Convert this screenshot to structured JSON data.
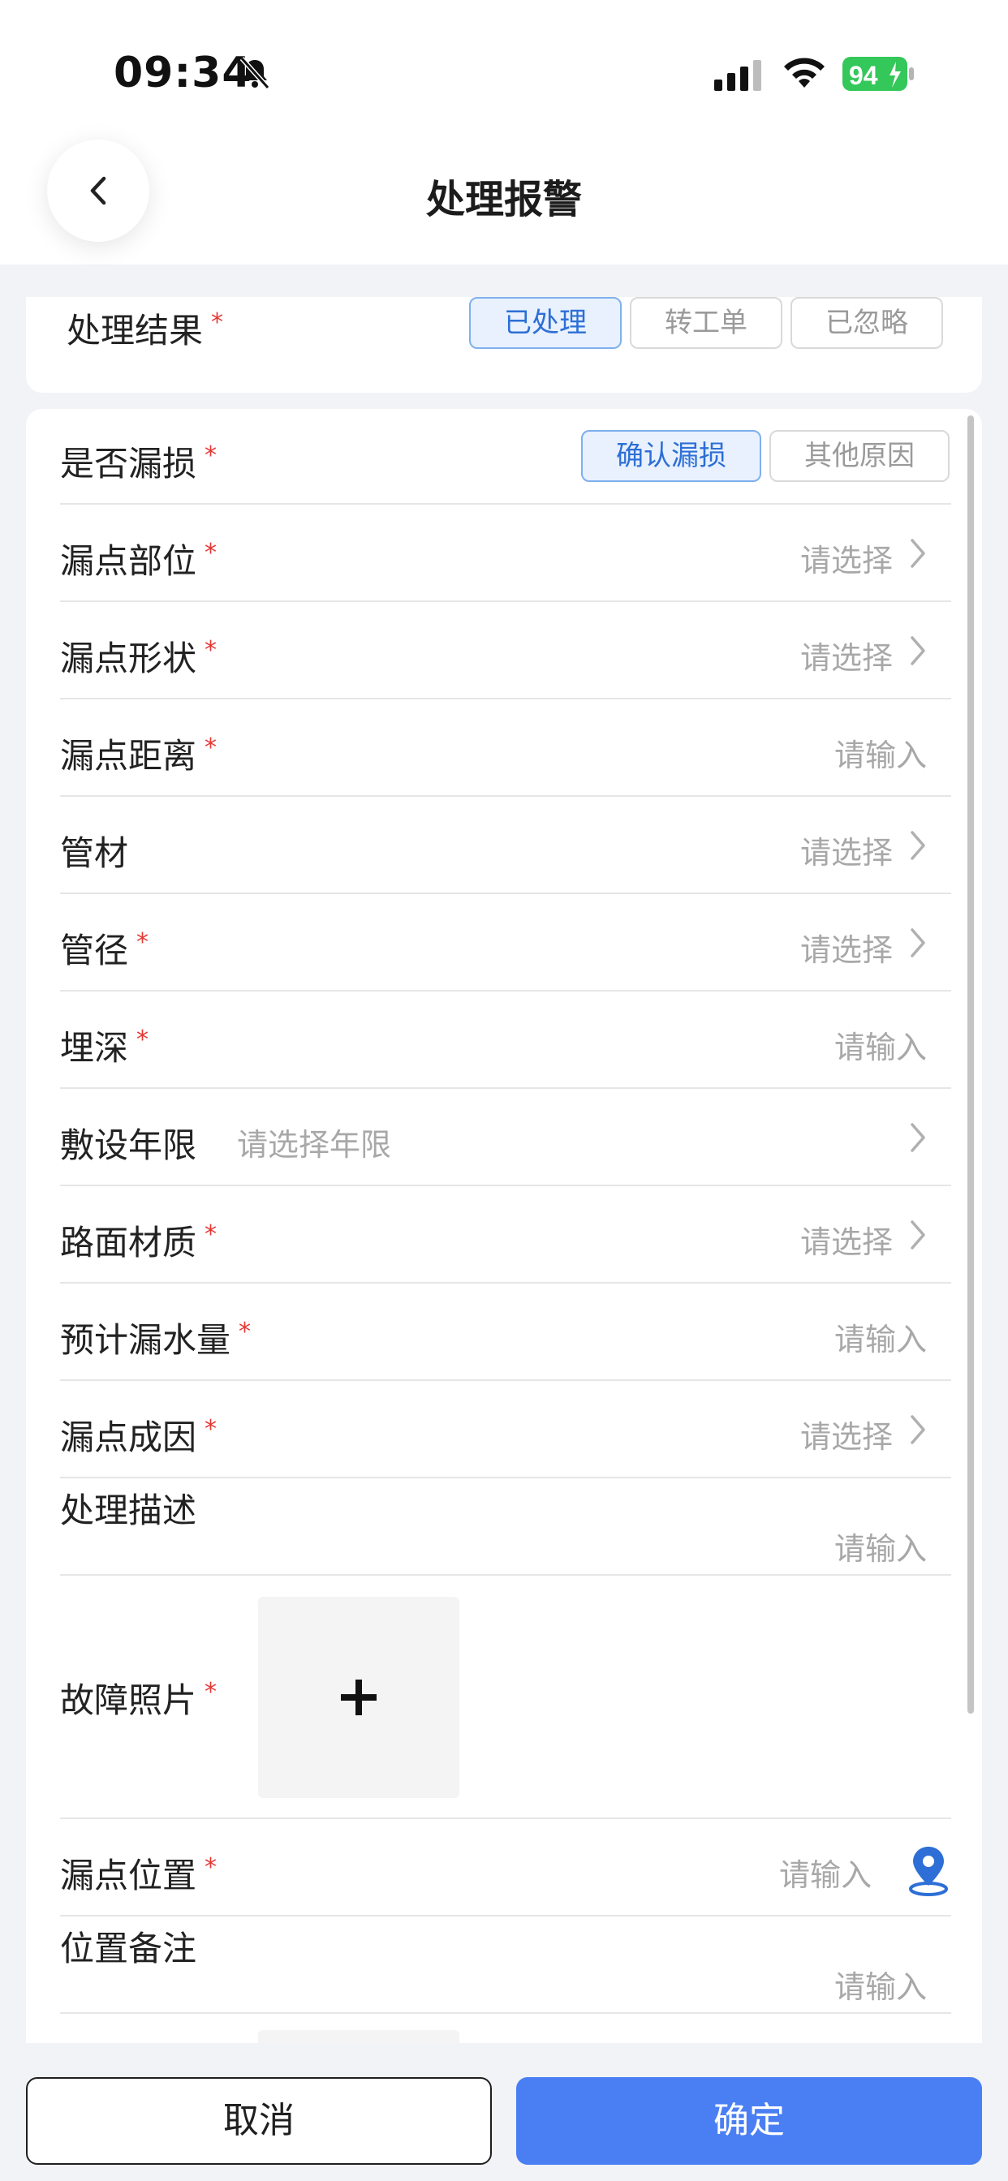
{
  "status_bar": {
    "time": "09:34",
    "battery": "94"
  },
  "header": {
    "title": "处理报警"
  },
  "result": {
    "label": "处理结果",
    "options": [
      "已处理",
      "转工单",
      "已忽略"
    ],
    "selected": "已处理"
  },
  "leak": {
    "label": "是否漏损",
    "options": [
      "确认漏损",
      "其他原因"
    ],
    "selected": "确认漏损"
  },
  "fields": [
    {
      "label": "漏点部位",
      "required": true,
      "value": "请选择"
    },
    {
      "label": "漏点形状",
      "required": true,
      "value": "请选择"
    },
    {
      "label": "漏点距离",
      "required": true,
      "value": "请输入"
    },
    {
      "label": "管材",
      "required": false,
      "value": "请选择"
    },
    {
      "label": "管径",
      "required": true,
      "value": "请选择"
    },
    {
      "label": "埋深",
      "required": true,
      "value": "请输入"
    },
    {
      "label": "敷设年限",
      "required": false,
      "value": "请选择年限"
    },
    {
      "label": "路面材质",
      "required": true,
      "value": "请选择"
    },
    {
      "label": "预计漏水量",
      "required": true,
      "value": "请输入"
    },
    {
      "label": "漏点成因",
      "required": true,
      "value": "请选择"
    },
    {
      "label": "处理描述",
      "required": false,
      "value": "请输入"
    },
    {
      "label": "故障照片",
      "required": true,
      "value": "+"
    },
    {
      "label": "漏点位置",
      "required": true,
      "value": "请输入"
    },
    {
      "label": "位置备注",
      "required": false,
      "value": "请输入"
    }
  ],
  "required_mark": "*",
  "buttons": {
    "cancel": "取消",
    "confirm": "确定"
  },
  "colors": {
    "accent": "#4a7ff4",
    "required": "#e53935",
    "selected_bg": "#e8f1fd",
    "selected_text": "#2d6fd6"
  }
}
